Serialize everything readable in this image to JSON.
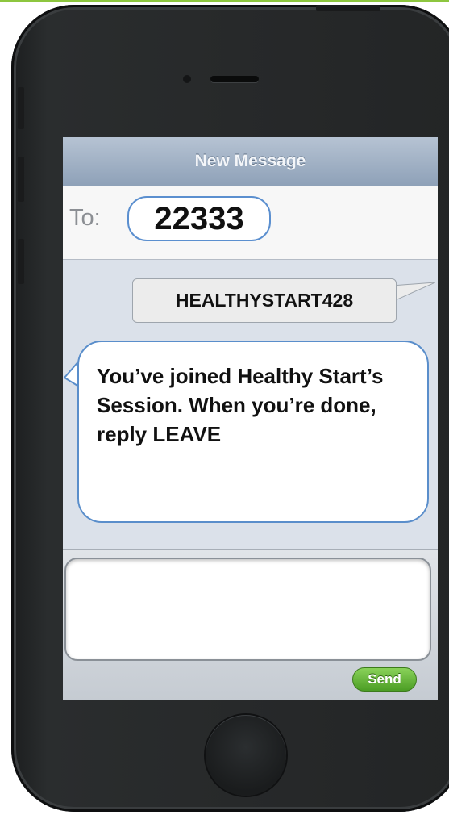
{
  "nav": {
    "title": "New Message"
  },
  "recipient": {
    "to_label": "To:",
    "number": "22333"
  },
  "messages": [
    {
      "text": "HEALTHYSTART428"
    },
    {
      "text": "You’ve joined Healthy Start’s Session. When you’re done, reply LEAVE"
    }
  ],
  "compose": {
    "placeholder": "",
    "send_label": "Send"
  },
  "colors": {
    "accent": "#5a8ecb",
    "send_green": "#4b9d24",
    "navbar": "#8ea1b8",
    "screen_bg": "#dbe1ea",
    "phone_body": "#27292a",
    "top_line": "#8dc63f"
  },
  "icons": [
    "speaker-icon",
    "camera-icon",
    "home-button-icon"
  ]
}
